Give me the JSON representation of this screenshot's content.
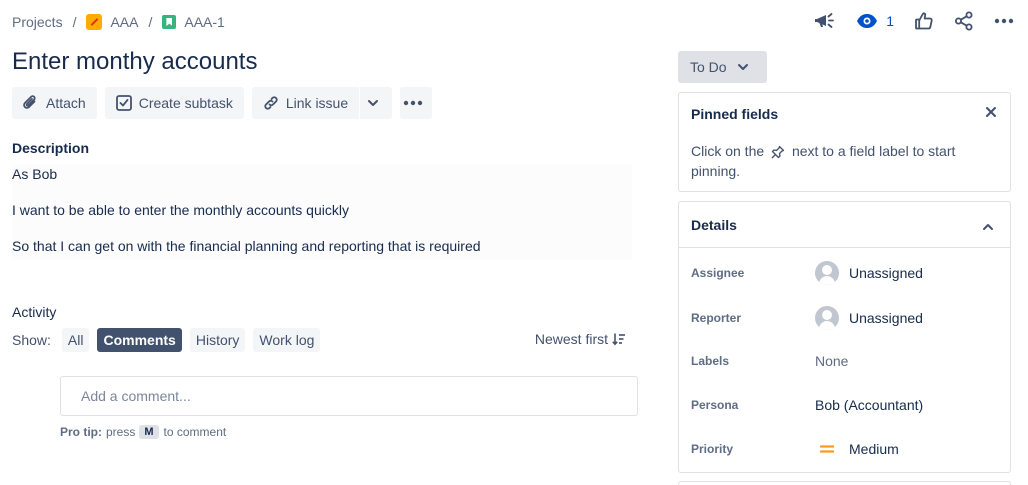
{
  "breadcrumb": {
    "projects": "Projects",
    "project": "AAA",
    "issue_key": "AAA-1",
    "separator": "/"
  },
  "header": {
    "watch_count": "1",
    "icons": [
      "megaphone-icon",
      "eye-icon",
      "thumbs-up-icon",
      "share-icon",
      "more-icon"
    ]
  },
  "issue": {
    "title": "Enter monthy accounts"
  },
  "toolbar": {
    "attach": "Attach",
    "create_subtask": "Create subtask",
    "link_issue": "Link issue"
  },
  "description": {
    "label": "Description",
    "lines": [
      "As Bob",
      "I want to be able to enter the monthly accounts quickly",
      "So that I can get on with the financial planning and reporting that is required"
    ]
  },
  "activity": {
    "label": "Activity",
    "show_label": "Show:",
    "filters": [
      {
        "label": "All",
        "active": false
      },
      {
        "label": "Comments",
        "active": true
      },
      {
        "label": "History",
        "active": false
      },
      {
        "label": "Work log",
        "active": false
      }
    ],
    "sort_label": "Newest first",
    "comment_placeholder": "Add a comment...",
    "protip_bold": "Pro tip:",
    "protip_press": "press",
    "protip_key": "M",
    "protip_after": "to comment"
  },
  "status": {
    "label": "To Do"
  },
  "pinned": {
    "title": "Pinned fields",
    "text_before": "Click on the",
    "text_after": "next to a field label to start pinning."
  },
  "details": {
    "title": "Details",
    "fields": [
      {
        "label": "Assignee",
        "value": "Unassigned"
      },
      {
        "label": "Reporter",
        "value": "Unassigned"
      },
      {
        "label": "Labels",
        "value": "None"
      },
      {
        "label": "Persona",
        "value": "Bob (Accountant)"
      },
      {
        "label": "Priority",
        "value": "Medium"
      }
    ]
  },
  "colors": {
    "accent": "#0052cc",
    "active_chip": "#42526e",
    "priority_medium": "#ff991f"
  }
}
